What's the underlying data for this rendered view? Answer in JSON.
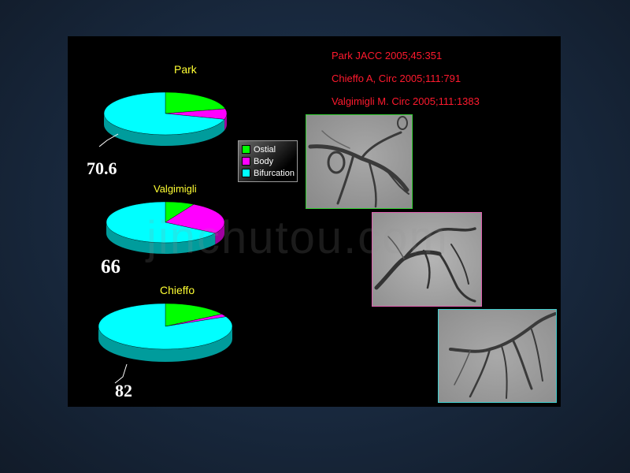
{
  "chart_data": [
    {
      "type": "pie",
      "title": "Park",
      "categories": [
        "Ostial",
        "Body",
        "Bifurcation"
      ],
      "values": [
        21.4,
        8.0,
        70.6
      ],
      "annotation": "70.6"
    },
    {
      "type": "pie",
      "title": "Valgimigli",
      "categories": [
        "Ostial",
        "Body",
        "Bifurcation"
      ],
      "values": [
        8.0,
        26.0,
        66.0
      ],
      "annotation": "66"
    },
    {
      "type": "pie",
      "title": "Chieffo",
      "categories": [
        "Ostial",
        "Body",
        "Bifurcation"
      ],
      "values": [
        16.0,
        2.0,
        82.0
      ],
      "annotation": "82"
    }
  ],
  "legend": {
    "items": [
      {
        "label": "Ostial",
        "color": "#00ff00"
      },
      {
        "label": "Body",
        "color": "#ff00ff"
      },
      {
        "label": "Bifurcation",
        "color": "#00ffff"
      }
    ]
  },
  "references": [
    "Park JACC 2005;45:351",
    "Chieffo A, Circ 2005;111:791",
    "Valgimigli M. Circ 2005;111:1383"
  ],
  "colors": {
    "ostial": "#00ff00",
    "body": "#ff00ff",
    "bifurcation": "#00ffff",
    "reference_text": "#ff1a2e",
    "title_text": "#ffff33",
    "frame_green": "#33cc33",
    "frame_pink": "#e060b0",
    "frame_cyan": "#40d0d0"
  },
  "watermark": "jinchutou.com"
}
